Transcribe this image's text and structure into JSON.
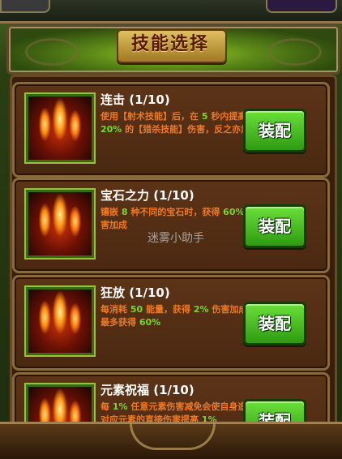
{
  "header": {
    "title": "技能选择"
  },
  "equip_label": "装配",
  "watermark": "迷雾小助手",
  "skills": [
    {
      "name": "连击 (1/10)",
      "desc": [
        {
          "t": "使用【射术技能】后，在 ",
          "c": "o"
        },
        {
          "t": "5",
          "c": "g"
        },
        {
          "t": " 秒内提高 ",
          "c": "o"
        },
        {
          "t": "20%",
          "c": "g"
        },
        {
          "t": " 的【猎杀技能】伤害，反之亦然",
          "c": "o"
        }
      ]
    },
    {
      "name": "宝石之力 (1/10)",
      "desc": [
        {
          "t": "镶嵌 ",
          "c": "o"
        },
        {
          "t": "8",
          "c": "g"
        },
        {
          "t": " 种不同的宝石时，获得 ",
          "c": "o"
        },
        {
          "t": "60%",
          "c": "g"
        },
        {
          "t": " 伤害加成",
          "c": "o"
        }
      ]
    },
    {
      "name": "狂放 (1/10)",
      "desc": [
        {
          "t": "每消耗 ",
          "c": "o"
        },
        {
          "t": "50",
          "c": "g"
        },
        {
          "t": " 能量，获得 ",
          "c": "o"
        },
        {
          "t": "2%",
          "c": "g"
        },
        {
          "t": " 伤害加成，最多获得 ",
          "c": "o"
        },
        {
          "t": "60%",
          "c": "g"
        }
      ]
    },
    {
      "name": "元素祝福 (1/10)",
      "desc": [
        {
          "t": "每 ",
          "c": "o"
        },
        {
          "t": "1%",
          "c": "g"
        },
        {
          "t": " 任意元素伤害减免会使自身造成对应元素的直接伤害提高 ",
          "c": "o"
        },
        {
          "t": "1%",
          "c": "g"
        }
      ]
    }
  ]
}
